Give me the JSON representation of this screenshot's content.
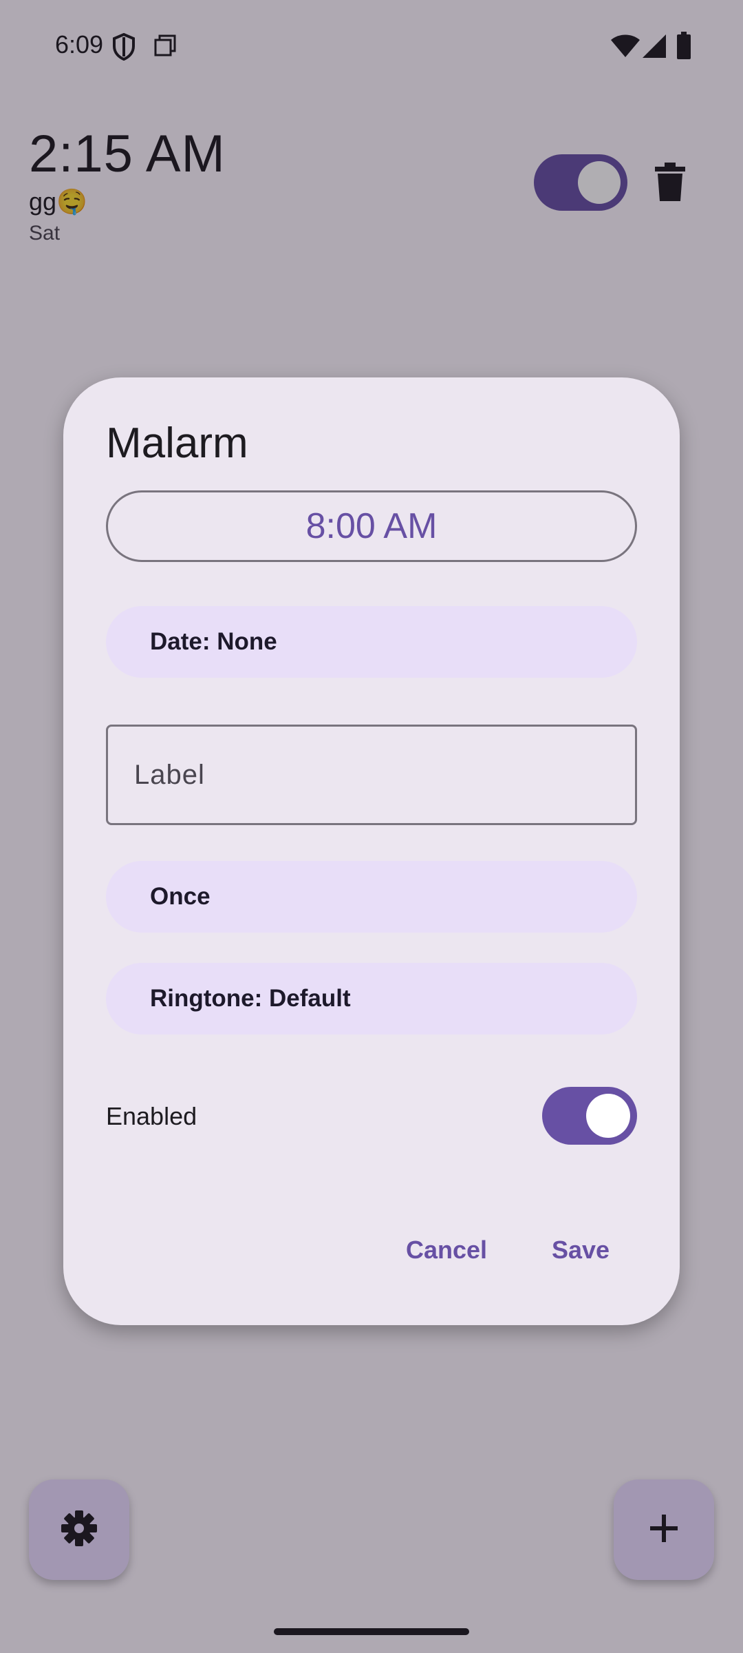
{
  "status_bar": {
    "time": "6:09",
    "icons": [
      "shield-icon",
      "screenshot-icon",
      "wifi-icon",
      "signal-icon",
      "battery-icon"
    ]
  },
  "background": {
    "alarm": {
      "time": "2:15 AM",
      "label": "gg🤤",
      "days": "Sat",
      "enabled": true
    },
    "fab_icons": [
      "gear-icon",
      "plus-icon"
    ]
  },
  "dialog": {
    "title": "Malarm",
    "time_button": "8:00 AM",
    "date_button": "Date: None",
    "label_placeholder": "Label",
    "label_value": "",
    "repeat_button": "Once",
    "ringtone_button": "Ringtone: Default",
    "enabled_text": "Enabled",
    "enabled": true,
    "cancel_label": "Cancel",
    "save_label": "Save"
  },
  "colors": {
    "primary": "#6750a4",
    "tonal_container": "#e8def8",
    "dialog_surface": "#ece6f0",
    "outline": "#79747e"
  }
}
